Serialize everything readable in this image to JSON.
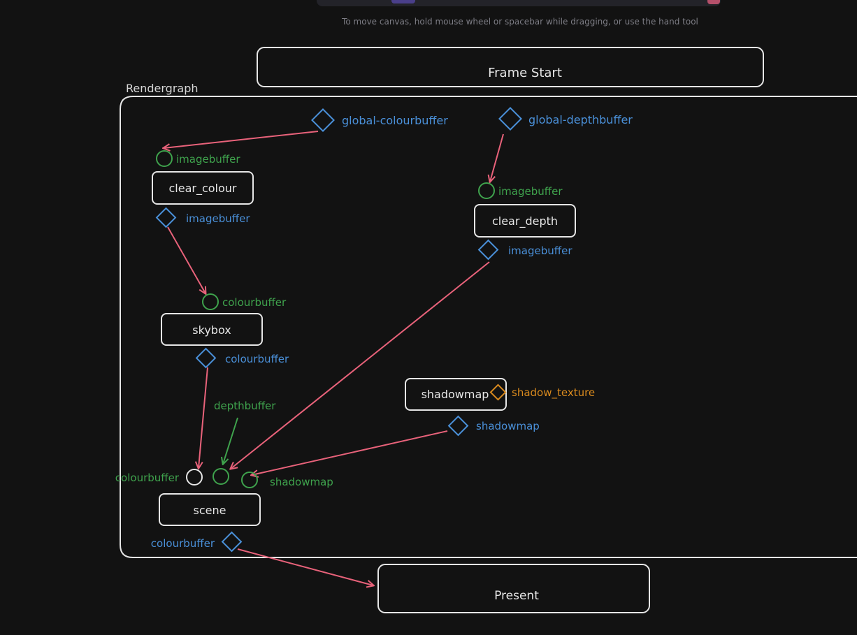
{
  "hint": "To move canvas, hold mouse wheel or spacebar while dragging, or use the hand tool",
  "frame_start": "Frame Start",
  "rendergraph_title": "Rendergraph",
  "present": "Present",
  "colors": {
    "background": "#121212",
    "box_stroke": "#e6e6e6",
    "arrow": "#e8627a",
    "input_port": "#3fa34d",
    "output_port": "#4a90d9",
    "texture_port": "#d98a1e"
  },
  "nodes": {
    "clear_colour": "clear_colour",
    "clear_depth": "clear_depth",
    "skybox": "skybox",
    "shadowmap": "shadowmap",
    "scene": "scene"
  },
  "resources": {
    "global_colourbuffer": "global-colourbuffer",
    "global_depthbuffer": "global-depthbuffer"
  },
  "ports": {
    "clear_colour_in": "imagebuffer",
    "clear_colour_out": "imagebuffer",
    "clear_depth_in": "imagebuffer",
    "clear_depth_out": "imagebuffer",
    "skybox_in": "colourbuffer",
    "skybox_out": "colourbuffer",
    "shadowmap_texture": "shadow_texture",
    "shadowmap_out": "shadowmap",
    "scene_in_colour": "colourbuffer",
    "scene_in_depth": "depthbuffer",
    "scene_in_shadow": "shadowmap",
    "scene_out": "colourbuffer"
  }
}
